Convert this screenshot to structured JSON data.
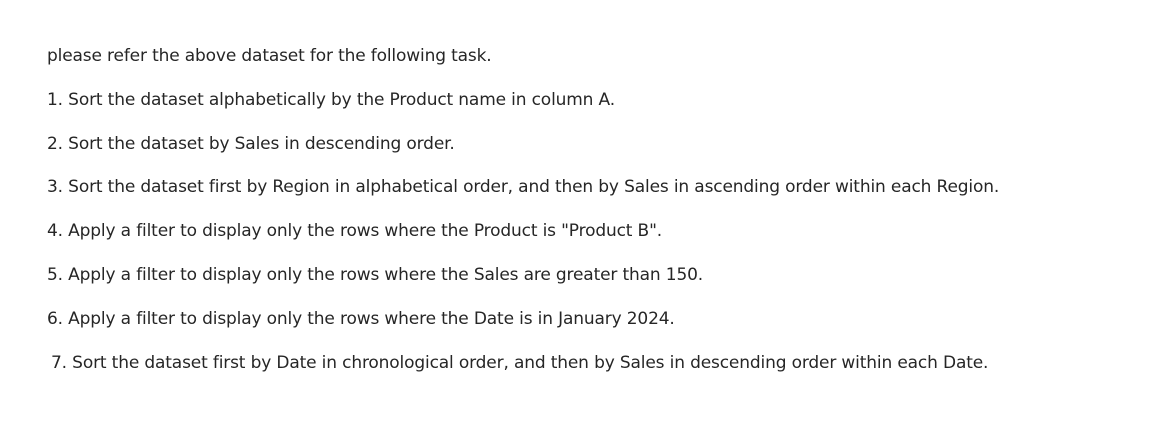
{
  "intro": "please refer the above dataset for the following task.",
  "tasks": [
    "1. Sort the dataset alphabetically by the Product name in column A.",
    "2. Sort the dataset by Sales in descending order.",
    "3. Sort the dataset first by Region in alphabetical order, and then by Sales in ascending order within each Region.",
    "4. Apply a filter to display only the rows where the Product is \"Product B\".",
    "5. Apply a filter to display only the rows where the Sales are greater than 150.",
    "6. Apply a filter to display only the rows where the Date is in January 2024.",
    "7. Sort the dataset first by Date in chronological order, and then by Sales in descending order within each Date."
  ]
}
